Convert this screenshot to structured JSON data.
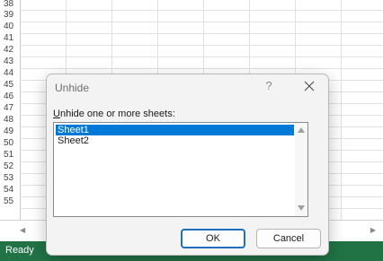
{
  "sheet": {
    "row_numbers": [
      "38",
      "39",
      "40",
      "41",
      "42",
      "43",
      "44",
      "45",
      "46",
      "47",
      "48",
      "49",
      "50",
      "51",
      "52",
      "53",
      "54",
      "55"
    ]
  },
  "status_bar": {
    "ready_label": "Ready",
    "accessibility_icon": "accessibility-icon",
    "color": "#217346"
  },
  "dialog": {
    "title": "Unhide",
    "help_label": "?",
    "close_icon": "close-icon",
    "list_label_accel": "U",
    "list_label_rest": "nhide one or more sheets:",
    "items": [
      {
        "label": "Sheet1",
        "selected": true
      },
      {
        "label": "Sheet2",
        "selected": false
      }
    ],
    "ok_label": "OK",
    "cancel_label": "Cancel",
    "selection_color": "#0078d7"
  }
}
